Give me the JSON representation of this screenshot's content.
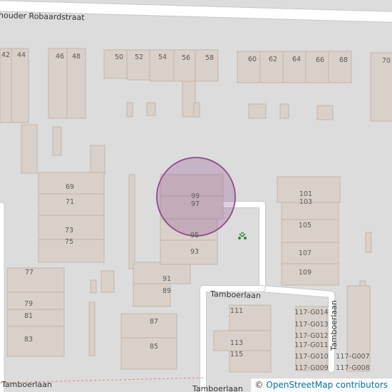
{
  "map": {
    "streets": {
      "top": "houder Robaardstraat",
      "tamboerlaan_mid": "Tamboerlaan",
      "tamboerlaan_left": "Tamboerlaan",
      "tamboerlaan_bottom": "Tamboerlaan",
      "tamboerlaan_vertical": "Tamboerlaan"
    },
    "house_numbers": {
      "n42": "42",
      "n44": "44",
      "n46": "46",
      "n48": "48",
      "n50": "50",
      "n52": "52",
      "n54": "54",
      "n56": "56",
      "n58": "58",
      "n60": "60",
      "n62": "62",
      "n64": "64",
      "n66": "66",
      "n68": "68",
      "n70": "70",
      "n69": "69",
      "n71": "71",
      "n73": "73",
      "n75": "75",
      "n77": "77",
      "n79": "79",
      "n81": "81",
      "n83": "83",
      "n85": "85",
      "n87": "87",
      "n89": "89",
      "n91": "91",
      "n93": "93",
      "n95": "95",
      "n97": "97",
      "n99": "99",
      "n101": "101",
      "n103": "103",
      "n105": "105",
      "n107": "107",
      "n109": "109",
      "n111": "111",
      "n113": "113",
      "n115": "115",
      "g014": "117-G014",
      "g013": "117-G013",
      "g012": "117-G012",
      "g011": "117-G011",
      "g010": "117-G010",
      "g009": "117-G009",
      "g007": "117-G007",
      "g008": "117-G008"
    },
    "marker": {
      "color": "#8e4b8e"
    },
    "colors": {
      "background": "#dcdcdc",
      "building": "#d9d0c9",
      "road": "#ffffff",
      "playground": "#2e8b2e"
    },
    "icons": {
      "playground": "playground-icon"
    }
  },
  "attribution": {
    "prefix": "©",
    "link": "OpenStreetMap contributors"
  }
}
